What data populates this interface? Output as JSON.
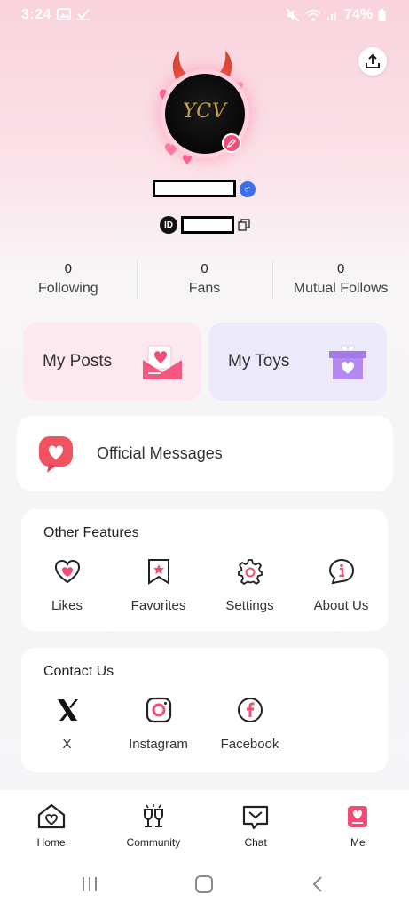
{
  "status_bar": {
    "time": "3:24",
    "battery": "74%"
  },
  "profile": {
    "avatar_text": "YCV",
    "id_badge": "ID"
  },
  "stats": [
    {
      "value": "0",
      "label": "Following"
    },
    {
      "value": "0",
      "label": "Fans"
    },
    {
      "value": "0",
      "label": "Mutual Follows"
    }
  ],
  "cards": {
    "posts": "My Posts",
    "toys": "My Toys"
  },
  "official": {
    "label": "Official Messages"
  },
  "features": {
    "title": "Other Features",
    "items": [
      {
        "label": "Likes",
        "icon": "heart-icon"
      },
      {
        "label": "Favorites",
        "icon": "bookmark-star-icon"
      },
      {
        "label": "Settings",
        "icon": "gear-icon"
      },
      {
        "label": "About Us",
        "icon": "info-icon"
      }
    ]
  },
  "contact": {
    "title": "Contact Us",
    "items": [
      {
        "label": "X",
        "icon": "x-logo-icon"
      },
      {
        "label": "Instagram",
        "icon": "instagram-icon"
      },
      {
        "label": "Facebook",
        "icon": "facebook-icon"
      }
    ]
  },
  "nav": [
    {
      "label": "Home",
      "icon": "home-icon"
    },
    {
      "label": "Community",
      "icon": "community-icon"
    },
    {
      "label": "Chat",
      "icon": "chat-icon"
    },
    {
      "label": "Me",
      "icon": "me-icon"
    }
  ],
  "colors": {
    "accent": "#ef4d74",
    "gender": "#3b6ff0",
    "posts_bg": "#fde8ef",
    "toys_bg": "#ece9fb"
  }
}
